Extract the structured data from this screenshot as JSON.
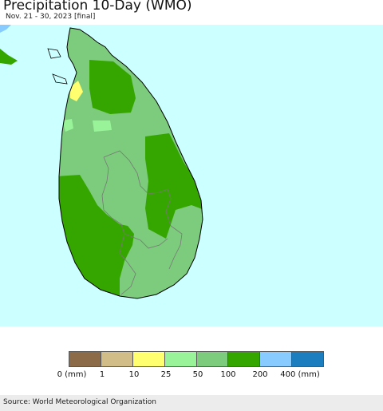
{
  "header": {
    "title": "Precipitation 10-Day (WMO)",
    "subtitle": "Nov. 21 - 30, 2023 [final]"
  },
  "map": {
    "region": "Sri Lanka",
    "colors": {
      "ocean": "#ccffff",
      "land_base": "#7dcb7d",
      "heavy": "#35a600",
      "light": "#99f499",
      "dry": "#ffff70",
      "border": "#000000"
    }
  },
  "legend": {
    "labels": [
      "0 (mm)",
      "1",
      "10",
      "25",
      "50",
      "100",
      "200",
      "400 (mm)"
    ],
    "colors": [
      "#8b6b48",
      "#d1bd88",
      "#ffff70",
      "#99f499",
      "#7dcb7d",
      "#35a600",
      "#87cbff",
      "#1d7ebf"
    ]
  },
  "footer": {
    "source": "Source: World Meteorological Organization"
  }
}
